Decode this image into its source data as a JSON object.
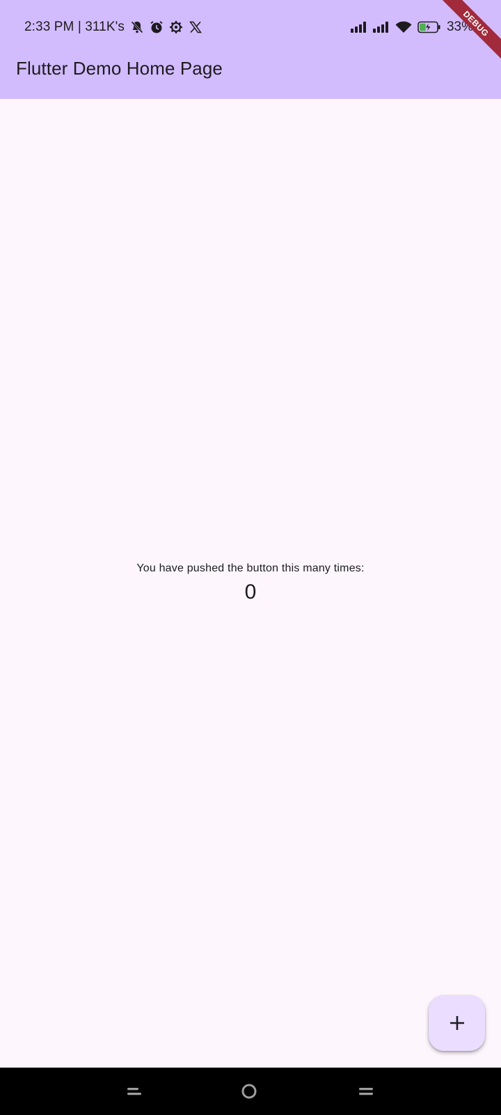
{
  "status_bar": {
    "time": "2:33 PM | 311K's",
    "battery_percent": "33%",
    "icons_left": [
      "mute-bell-icon",
      "alarm-icon",
      "settings-icon",
      "x-logo-icon"
    ],
    "icons_right": [
      "signal-icon",
      "signal-icon",
      "wifi-icon",
      "battery-charging-icon"
    ]
  },
  "app_bar": {
    "title": "Flutter Demo Home Page"
  },
  "debug_banner": {
    "label": "DEBUG"
  },
  "body": {
    "caption": "You have pushed the button this many times:",
    "counter": "0"
  },
  "fab": {
    "icon": "plus-icon"
  },
  "nav_bar": {
    "buttons": [
      "recents-icon",
      "home-icon",
      "back-icon"
    ]
  },
  "colors": {
    "app_bar": "#d3bcfd",
    "background": "#fdf7fd",
    "fab": "#eaddff",
    "debug_ribbon": "#a12a3b",
    "nav_bar": "#000000",
    "text": "#1d1b20"
  }
}
